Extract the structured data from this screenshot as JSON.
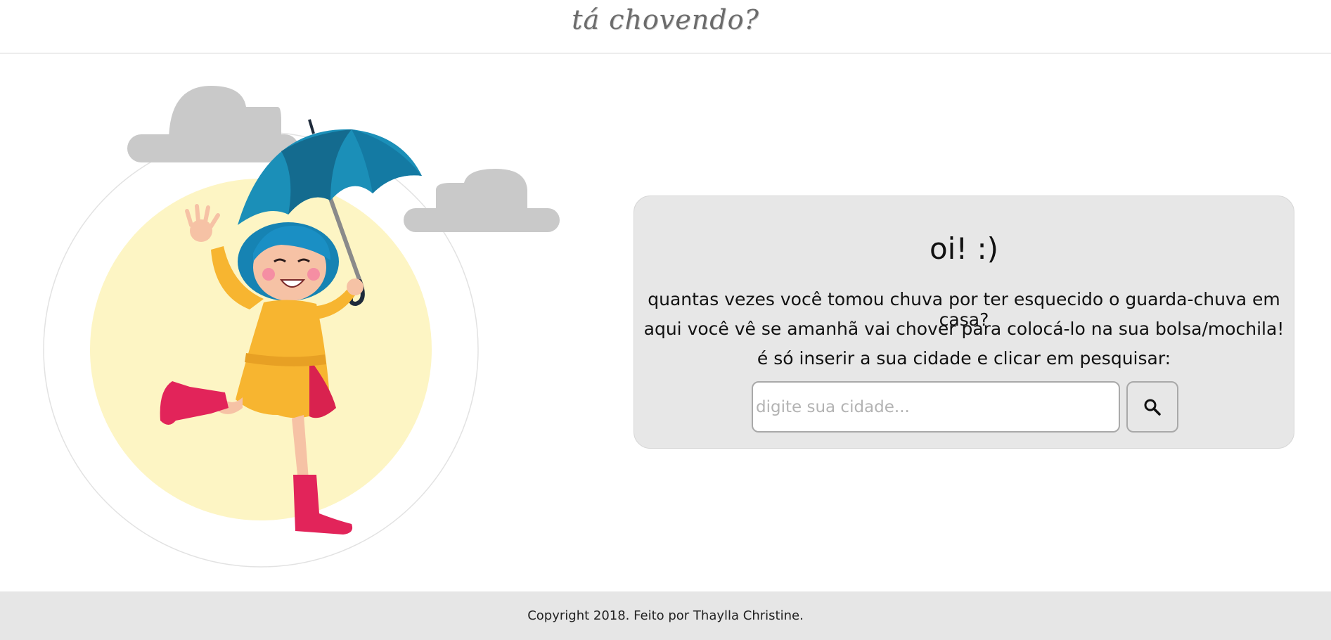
{
  "header": {
    "logo_text": "tá chovendo?"
  },
  "card": {
    "greeting": "oi! :)",
    "line1": "quantas vezes você tomou chuva por ter esquecido o guarda-chuva em casa?",
    "line2": "aqui você vê se amanhã vai chover para colocá-lo na sua bolsa/mochila!",
    "line3": "é só inserir a sua cidade e clicar em pesquisar:",
    "search": {
      "placeholder": "digite sua cidade...",
      "value": "",
      "button_icon": "search-icon"
    }
  },
  "footer": {
    "copyright": "Copyright 2018. Feito por Thaylla Christine."
  },
  "colors": {
    "card_bg": "#e7e7e7",
    "footer_bg": "#e6e6e6",
    "sun": "#fdf5c4",
    "cloud": "#c9c9c9",
    "umbrella": "#1b8fb8",
    "raincoat": "#f7b530",
    "boots": "#e2245a",
    "hair": "#1a8fc4"
  }
}
